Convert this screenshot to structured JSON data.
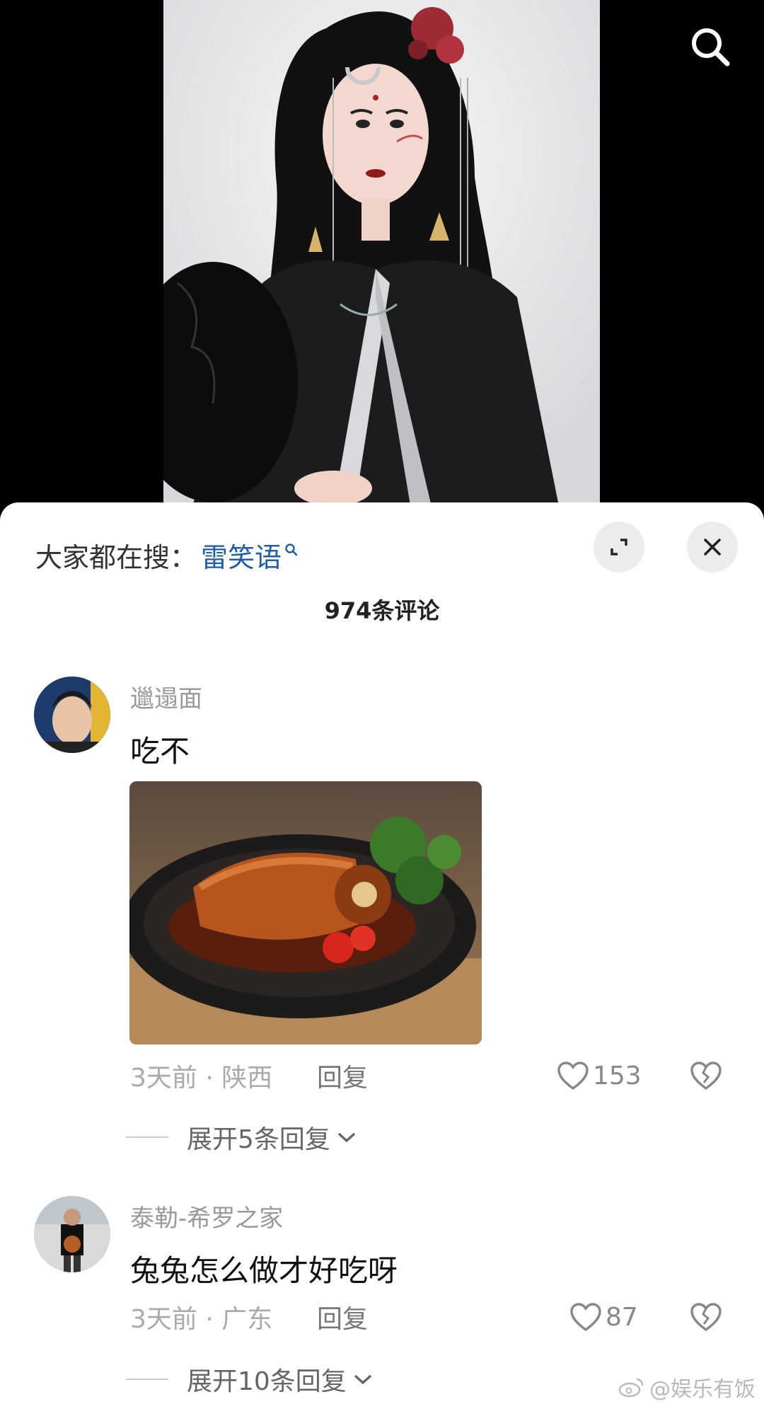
{
  "video": {
    "search_icon": "search-icon"
  },
  "panel": {
    "trending_label": "大家都在搜：",
    "trending_term": "雷笑语",
    "comment_count": "974条评论"
  },
  "comments": [
    {
      "username": "邋遢面",
      "text": "吃不",
      "time_location": "3天前 · 陕西",
      "reply_label": "回复",
      "likes": "153",
      "expand_label": "展开5条回复"
    },
    {
      "username": "泰勒-希罗之家",
      "text": "兔兔怎么做才好吃呀",
      "time_location": "3天前 · 广东",
      "reply_label": "回复",
      "likes": "87",
      "expand_label": "展开10条回复"
    }
  ],
  "watermark": "@娱乐有饭"
}
